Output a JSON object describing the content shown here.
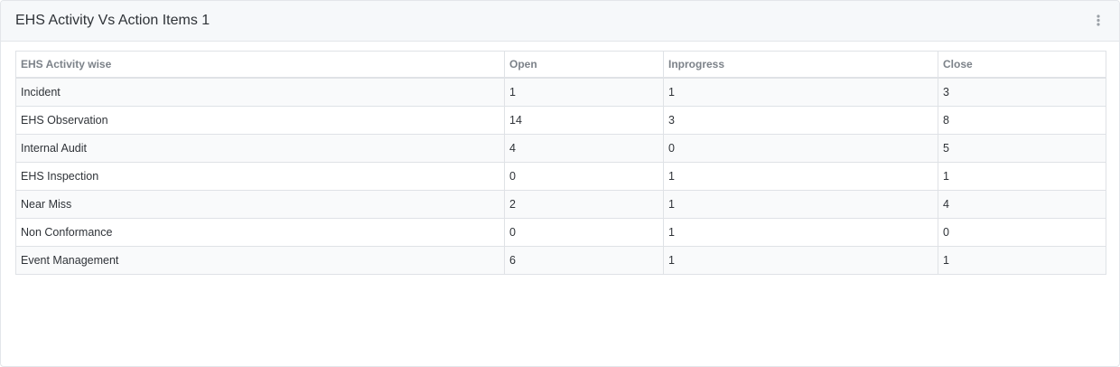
{
  "widget": {
    "title": "EHS Activity Vs Action Items 1",
    "menu_icon": "more-vertical-icon"
  },
  "table": {
    "headers": [
      "EHS Activity wise",
      "Open",
      "Inprogress",
      "Close"
    ],
    "rows": [
      {
        "activity": "Incident",
        "open": "1",
        "inprogress": "1",
        "close": "3"
      },
      {
        "activity": "EHS Observation",
        "open": "14",
        "inprogress": "3",
        "close": "8"
      },
      {
        "activity": "Internal Audit",
        "open": "4",
        "inprogress": "0",
        "close": "5"
      },
      {
        "activity": "EHS Inspection",
        "open": "0",
        "inprogress": "1",
        "close": "1"
      },
      {
        "activity": "Near Miss",
        "open": "2",
        "inprogress": "1",
        "close": "4"
      },
      {
        "activity": "Non Conformance",
        "open": "0",
        "inprogress": "1",
        "close": "0"
      },
      {
        "activity": "Event Management",
        "open": "6",
        "inprogress": "1",
        "close": "1"
      }
    ]
  }
}
